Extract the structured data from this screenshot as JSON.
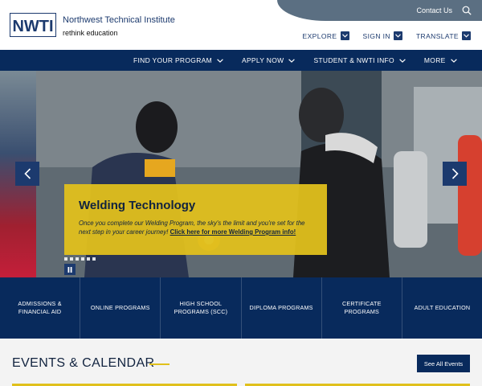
{
  "header": {
    "brand_name": "Northwest Technical Institute",
    "brand_tagline": "rethink education",
    "logo_text": "NWTI",
    "contact_label": "Contact Us",
    "utility_nav": [
      {
        "label": "EXPLORE"
      },
      {
        "label": "SIGN IN"
      },
      {
        "label": "TRANSLATE"
      }
    ]
  },
  "main_nav": {
    "items": [
      {
        "label": "FIND YOUR PROGRAM"
      },
      {
        "label": "APPLY NOW"
      },
      {
        "label": "STUDENT & NWTI INFO"
      },
      {
        "label": "MORE"
      }
    ]
  },
  "hero": {
    "title": "Welding Technology",
    "body": "Once you complete our Welding Program, the sky's the limit and you're set for the next step in your career journey!",
    "link_text": "Click here for more Welding Program info!",
    "slide_count": 6
  },
  "quick_links": [
    {
      "label": "ADMISSIONS & FINANCIAL AID"
    },
    {
      "label": "ONLINE PROGRAMS"
    },
    {
      "label": "HIGH SCHOOL PROGRAMS (SCC)"
    },
    {
      "label": "DIPLOMA PROGRAMS"
    },
    {
      "label": "CERTIFICATE PROGRAMS"
    },
    {
      "label": "ADULT EDUCATION"
    }
  ],
  "events": {
    "title": "EVENTS & CALENDAR",
    "button_label": "See All Events"
  },
  "colors": {
    "navy": "#082a5c",
    "brand_blue": "#1c3a6e",
    "gold": "#e0c01c",
    "topbar_slate": "#5b6f82"
  },
  "icons": {
    "search": "search-icon",
    "chevron": "chevron-down-icon",
    "prev": "chevron-left-icon",
    "next": "chevron-right-icon",
    "pause": "pause-icon"
  }
}
